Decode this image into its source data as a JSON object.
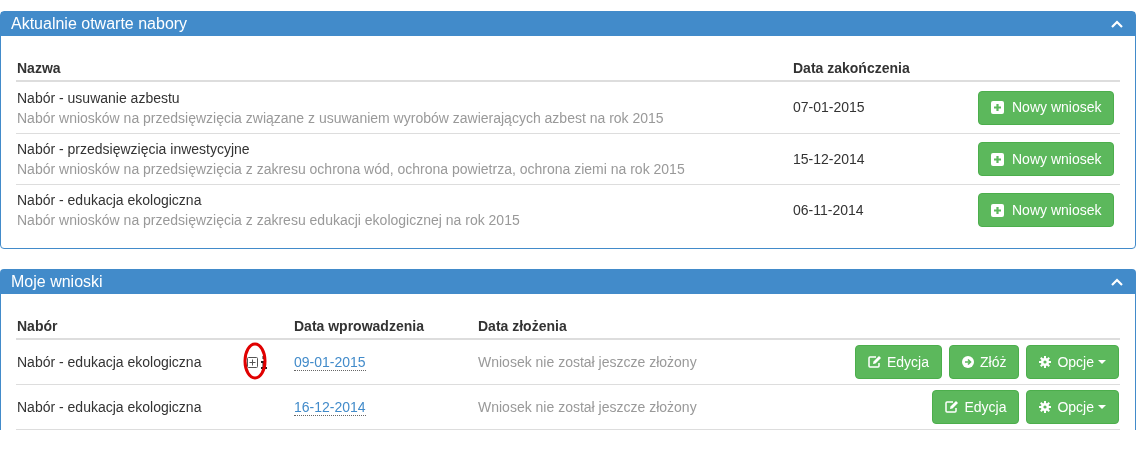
{
  "open_calls": {
    "title": "Aktualnie otwarte nabory",
    "expanded": true,
    "columns": [
      "Nazwa",
      "Data zakończenia"
    ],
    "rows": [
      {
        "name": "Nabór - usuwanie azbestu",
        "description": "Nabór wniosków na przedsięwzięcia związane z usuwaniem wyrobów zawierających azbest na rok 2015",
        "end_date": "07-01-2015",
        "button": "Nowy wniosek"
      },
      {
        "name": "Nabór - przedsięwzięcia inwestycyjne",
        "description": "Nabór wniosków na przedsięwzięcia z zakresu ochrona wód, ochrona powietrza, ochrona ziemi na rok 2015",
        "end_date": "15-12-2014",
        "button": "Nowy wniosek"
      },
      {
        "name": "Nabór - edukacja ekologiczna",
        "description": "Nabór wniosków na przedsięwzięcia z zakresu edukacji ekologicznej na rok 2015",
        "end_date": "06-11-2014",
        "button": "Nowy wniosek"
      }
    ]
  },
  "my_applications": {
    "title": "Moje wnioski",
    "expanded": true,
    "columns": [
      "Nabór",
      "Data wprowadzenia",
      "Data złożenia"
    ],
    "rows": [
      {
        "call": "Nabór - edukacja ekologiczna",
        "has_details": true,
        "entry_date": "09-01-2015",
        "submission": "Wniosek nie został jeszcze złożony",
        "buttons": [
          {
            "kind": "edit",
            "label": "Edycja"
          },
          {
            "kind": "submit",
            "label": "Złóż"
          },
          {
            "kind": "options",
            "label": "Opcje"
          }
        ]
      },
      {
        "call": "Nabór - edukacja ekologiczna",
        "has_details": false,
        "entry_date": "16-12-2014",
        "submission": "Wniosek nie został jeszcze złożony",
        "buttons": [
          {
            "kind": "edit",
            "label": "Edycja"
          },
          {
            "kind": "options",
            "label": "Opcje"
          }
        ]
      }
    ]
  }
}
